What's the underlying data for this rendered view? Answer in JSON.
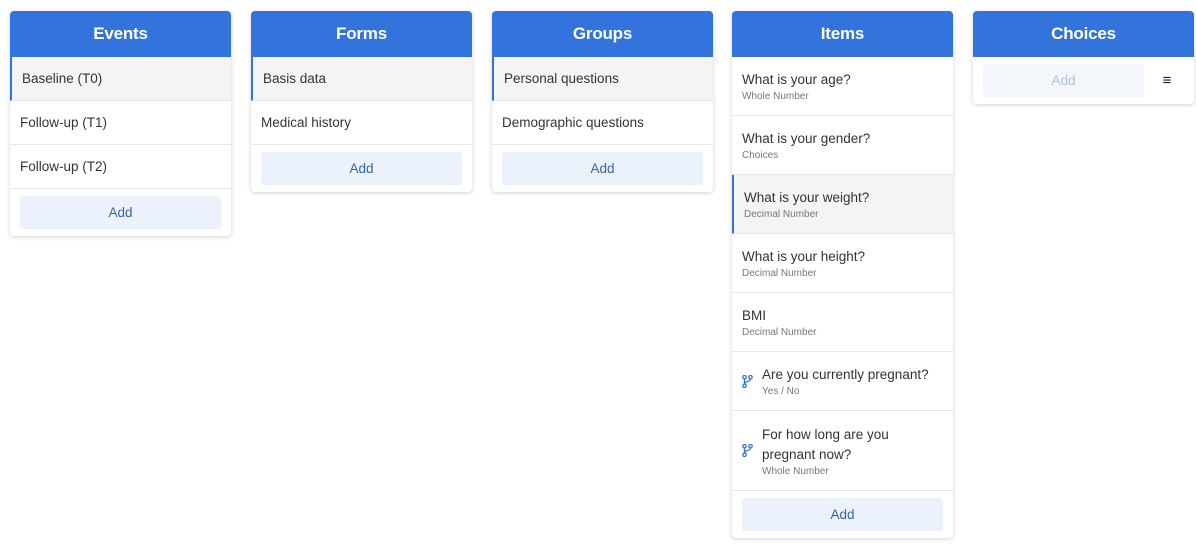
{
  "events": {
    "title": "Events",
    "items": [
      {
        "label": "Baseline (T0)"
      },
      {
        "label": "Follow-up (T1)"
      },
      {
        "label": "Follow-up (T2)"
      }
    ],
    "add_label": "Add"
  },
  "forms": {
    "title": "Forms",
    "items": [
      {
        "label": "Basis data"
      },
      {
        "label": "Medical history"
      }
    ],
    "add_label": "Add"
  },
  "groups": {
    "title": "Groups",
    "items": [
      {
        "label": "Personal questions"
      },
      {
        "label": "Demographic questions"
      }
    ],
    "add_label": "Add"
  },
  "items": {
    "title": "Items",
    "items": [
      {
        "label": "What is your age?",
        "type": "Whole Number"
      },
      {
        "label": "What is your gender?",
        "type": "Choices"
      },
      {
        "label": "What is your weight?",
        "type": "Decimal Number"
      },
      {
        "label": "What is your height?",
        "type": "Decimal Number"
      },
      {
        "label": "BMI",
        "type": "Decimal Number"
      },
      {
        "label": "Are you currently pregnant?",
        "type": "Yes / No",
        "icon": "branch-icon"
      },
      {
        "label": "For how long are you pregnant now?",
        "type": "Whole Number",
        "icon": "branch-icon"
      }
    ],
    "add_label": "Add"
  },
  "choices": {
    "title": "Choices",
    "add_label": "Add",
    "menu_icon": "≡"
  },
  "colors": {
    "header": "#3373dc",
    "add_bg": "#ecf2fb",
    "add_text": "#3563ab",
    "active_bg": "#f4f4f4"
  }
}
